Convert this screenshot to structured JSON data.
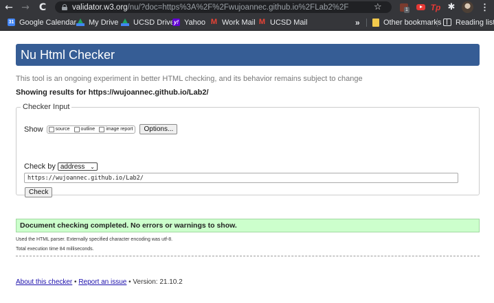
{
  "browser": {
    "url_domain": "validator.w3.org",
    "url_path": "/nu/?doc=https%3A%2F%2Fwujoannec.github.io%2FLab2%2F",
    "extension_badge": "1",
    "bookmarks": [
      {
        "label": "Google Calendar",
        "icon": "calendar-icon"
      },
      {
        "label": "My Drive",
        "icon": "drive-icon"
      },
      {
        "label": "UCSD Drive",
        "icon": "drive-icon"
      },
      {
        "label": "Yahoo",
        "icon": "yahoo-icon"
      },
      {
        "label": "Work Mail",
        "icon": "gmail-icon"
      },
      {
        "label": "UCSD Mail",
        "icon": "gmail-icon"
      }
    ],
    "overflow_label": "»",
    "other_bookmarks": "Other bookmarks",
    "reading_list": "Reading list"
  },
  "page": {
    "title": "Nu Html Checker",
    "intro": "This tool is an ongoing experiment in better HTML checking, and its behavior remains subject to change",
    "showing": "Showing results for https://wujoannec.github.io/Lab2/",
    "checker_input": {
      "legend": "Checker Input",
      "show_label": "Show",
      "show_options": [
        "source",
        "outline",
        "image report"
      ],
      "options_button": "Options...",
      "check_by_label": "Check by",
      "check_by_value": "address",
      "url_value": "https://wujoannec.github.io/Lab2/",
      "check_button": "Check"
    },
    "result": "Document checking completed. No errors or warnings to show.",
    "notes": [
      "Used the HTML parser. Externally specified character encoding was utf-8.",
      "Total execution time 84 milliseconds."
    ],
    "footer": {
      "about": "About this checker",
      "sep1": " • ",
      "report": "Report an issue",
      "version": " • Version: 21.10.2"
    }
  },
  "colors": {
    "header": "#365d95",
    "success_bg": "#ccffcc",
    "link": "#1a0dab",
    "chrome_dark": "#35363a"
  }
}
